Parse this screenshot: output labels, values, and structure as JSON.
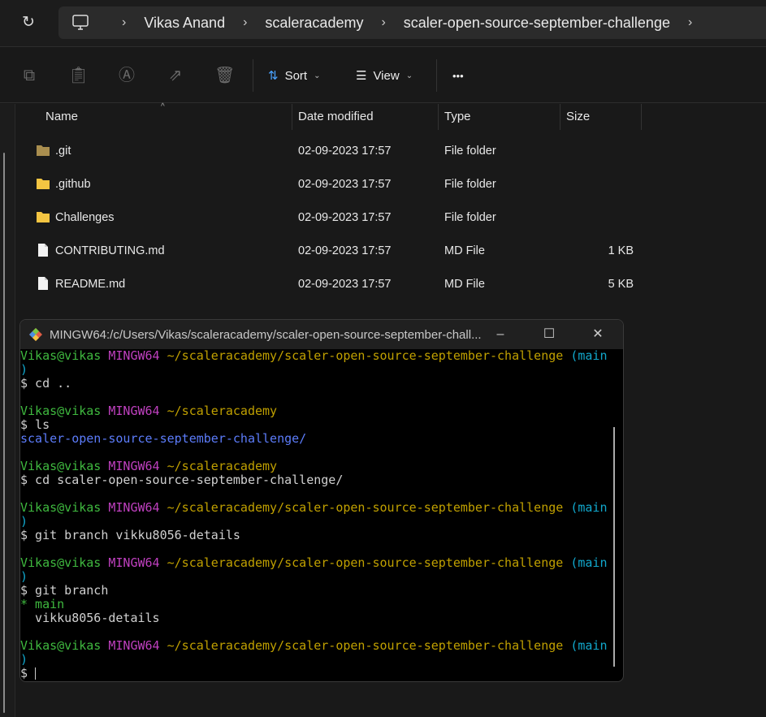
{
  "address": {
    "breadcrumbs": [
      "Vikas Anand",
      "scaleracademy",
      "scaler-open-source-september-challenge"
    ]
  },
  "toolbar": {
    "sort_label": "Sort",
    "view_label": "View",
    "more_label": "•••"
  },
  "columns": {
    "name": "Name",
    "date": "Date modified",
    "type": "Type",
    "size": "Size"
  },
  "files": [
    {
      "name": ".git",
      "date": "02-09-2023 17:57",
      "type": "File folder",
      "size": "",
      "kind": "folder-dim"
    },
    {
      "name": ".github",
      "date": "02-09-2023 17:57",
      "type": "File folder",
      "size": "",
      "kind": "folder"
    },
    {
      "name": "Challenges",
      "date": "02-09-2023 17:57",
      "type": "File folder",
      "size": "",
      "kind": "folder"
    },
    {
      "name": "CONTRIBUTING.md",
      "date": "02-09-2023 17:57",
      "type": "MD File",
      "size": "1 KB",
      "kind": "file"
    },
    {
      "name": "README.md",
      "date": "02-09-2023 17:57",
      "type": "MD File",
      "size": "5 KB",
      "kind": "file"
    }
  ],
  "terminal": {
    "title": "MINGW64:/c/Users/Vikas/scaleracademy/scaler-open-source-september-chall...",
    "lines": [
      [
        [
          "g",
          "Vikas@vikas "
        ],
        [
          "m",
          "MINGW64 "
        ],
        [
          "y",
          "~/scaleracademy/scaler-open-source-september-challenge "
        ],
        [
          "c",
          "(main"
        ]
      ],
      [
        [
          "c",
          ")"
        ]
      ],
      [
        [
          "w",
          "$ cd .."
        ]
      ],
      [],
      [
        [
          "g",
          "Vikas@vikas "
        ],
        [
          "m",
          "MINGW64 "
        ],
        [
          "y",
          "~/scaleracademy"
        ]
      ],
      [
        [
          "w",
          "$ ls"
        ]
      ],
      [
        [
          "b",
          "scaler-open-source-september-challenge/"
        ]
      ],
      [],
      [
        [
          "g",
          "Vikas@vikas "
        ],
        [
          "m",
          "MINGW64 "
        ],
        [
          "y",
          "~/scaleracademy"
        ]
      ],
      [
        [
          "w",
          "$ cd scaler-open-source-september-challenge/"
        ]
      ],
      [],
      [
        [
          "g",
          "Vikas@vikas "
        ],
        [
          "m",
          "MINGW64 "
        ],
        [
          "y",
          "~/scaleracademy/scaler-open-source-september-challenge "
        ],
        [
          "c",
          "(main"
        ]
      ],
      [
        [
          "c",
          ")"
        ]
      ],
      [
        [
          "w",
          "$ git branch vikku8056-details"
        ]
      ],
      [],
      [
        [
          "g",
          "Vikas@vikas "
        ],
        [
          "m",
          "MINGW64 "
        ],
        [
          "y",
          "~/scaleracademy/scaler-open-source-september-challenge "
        ],
        [
          "c",
          "(main"
        ]
      ],
      [
        [
          "c",
          ")"
        ]
      ],
      [
        [
          "w",
          "$ git branch"
        ]
      ],
      [
        [
          "g",
          "* main"
        ]
      ],
      [
        [
          "w",
          "  vikku8056-details"
        ]
      ],
      [],
      [
        [
          "g",
          "Vikas@vikas "
        ],
        [
          "m",
          "MINGW64 "
        ],
        [
          "y",
          "~/scaleracademy/scaler-open-source-september-challenge "
        ],
        [
          "c",
          "(main"
        ]
      ],
      [
        [
          "c",
          ")"
        ]
      ],
      [
        [
          "w",
          "$ "
        ]
      ]
    ]
  }
}
